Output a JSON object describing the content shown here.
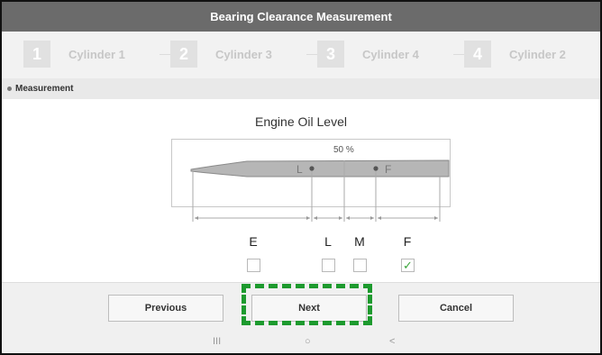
{
  "window": {
    "title": "Bearing Clearance Measurement"
  },
  "steps": [
    {
      "number": "1",
      "label": "Cylinder 1"
    },
    {
      "number": "2",
      "label": "Cylinder 3"
    },
    {
      "number": "3",
      "label": "Cylinder 4"
    },
    {
      "number": "4",
      "label": "Cylinder 2"
    }
  ],
  "section": {
    "label": "Measurement"
  },
  "main": {
    "title": "Engine Oil Level",
    "percent_label": "50 %",
    "dipstick_marks": [
      "L",
      "F"
    ],
    "levels": [
      {
        "label": "E",
        "checked": false
      },
      {
        "label": "L",
        "checked": false
      },
      {
        "label": "M",
        "checked": false
      },
      {
        "label": "F",
        "checked": true
      }
    ]
  },
  "buttons": {
    "previous": "Previous",
    "next": "Next",
    "cancel": "Cancel"
  },
  "nav": {
    "recents": "III",
    "home": "○",
    "back": "<"
  },
  "colors": {
    "title_bar": "#6b6b6b",
    "highlight": "#1d9a2e",
    "checkmark": "#3aa53a"
  }
}
